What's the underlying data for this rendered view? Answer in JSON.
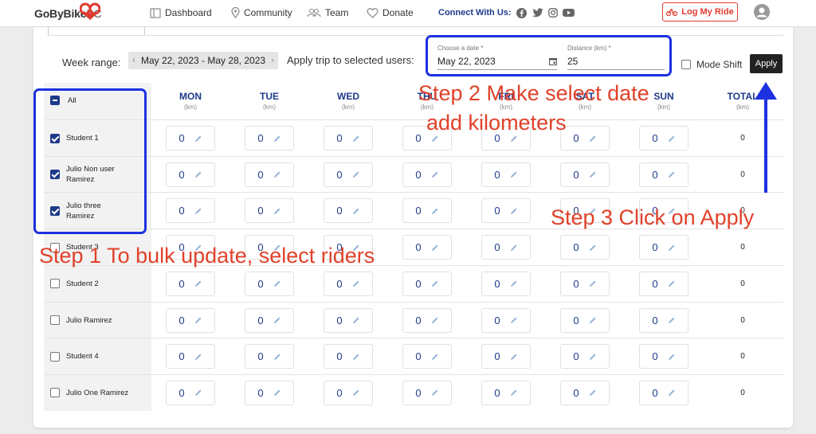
{
  "header": {
    "logo_main": "GoByBike",
    "logo_suffix": "BC",
    "nav": [
      {
        "label": "Dashboard",
        "icon": "dashboard-icon"
      },
      {
        "label": "Community",
        "icon": "location-pin-icon"
      },
      {
        "label": "Team",
        "icon": "team-icon"
      },
      {
        "label": "Donate",
        "icon": "heart-icon"
      }
    ],
    "connect_label": "Connect With Us:",
    "social": [
      "facebook-icon",
      "twitter-icon",
      "instagram-icon",
      "youtube-icon"
    ],
    "log_ride_label": "Log My Ride",
    "accent_color": "#e03a2f",
    "brand_blue": "#1e3a8a"
  },
  "controls": {
    "week_label": "Week range:",
    "week_value": "May 22, 2023 - May 28, 2023",
    "apply_trip_label": "Apply trip to selected users:",
    "date_caption": "Choose a date *",
    "date_value": "May 22, 2023",
    "distance_caption": "Distance (km) *",
    "distance_value": "25",
    "mode_shift_label": "Mode Shift",
    "apply_label": "Apply"
  },
  "table": {
    "all_label": "All",
    "days": [
      {
        "name": "MON",
        "unit": "(km)"
      },
      {
        "name": "TUE",
        "unit": "(km)"
      },
      {
        "name": "WED",
        "unit": "(km)"
      },
      {
        "name": "THU",
        "unit": "(km)"
      },
      {
        "name": "FRI",
        "unit": "(km)"
      },
      {
        "name": "SAT",
        "unit": "(km)"
      },
      {
        "name": "SUN",
        "unit": "(km)"
      }
    ],
    "total_header": "TOTAL",
    "total_unit": "(km)",
    "rows": [
      {
        "name": "Student 1",
        "checked": true,
        "values": [
          "0",
          "0",
          "0",
          "0",
          "0",
          "0",
          "0"
        ],
        "total": "0"
      },
      {
        "name": "Julio Non user Ramirez",
        "checked": true,
        "values": [
          "0",
          "0",
          "0",
          "0",
          "0",
          "0",
          "0"
        ],
        "total": "0"
      },
      {
        "name": "Julio three Ramirez",
        "checked": true,
        "values": [
          "0",
          "0",
          "0",
          "0",
          "0",
          "0",
          "0"
        ],
        "total": "0"
      },
      {
        "name": "Student 3",
        "checked": false,
        "values": [
          "0",
          "0",
          "0",
          "0",
          "0",
          "0",
          "0"
        ],
        "total": "0"
      },
      {
        "name": "Student 2",
        "checked": false,
        "values": [
          "0",
          "0",
          "0",
          "0",
          "0",
          "0",
          "0"
        ],
        "total": "0"
      },
      {
        "name": "Julio Ramirez",
        "checked": false,
        "values": [
          "0",
          "0",
          "0",
          "0",
          "0",
          "0",
          "0"
        ],
        "total": "0"
      },
      {
        "name": "Student 4",
        "checked": false,
        "values": [
          "0",
          "0",
          "0",
          "0",
          "0",
          "0",
          "0"
        ],
        "total": "0"
      },
      {
        "name": "Julio One Ramirez",
        "checked": false,
        "values": [
          "0",
          "0",
          "0",
          "0",
          "0",
          "0",
          "0"
        ],
        "total": "0"
      }
    ]
  },
  "annotations": {
    "step1": "Step 1 To bulk update, select riders",
    "step2_line1": "Step 2 Make select date",
    "step2_line2": "add kilometers",
    "step3": "Step 3 Click on Apply",
    "highlight_color": "#1c31e0",
    "text_color": "#e0412a"
  }
}
